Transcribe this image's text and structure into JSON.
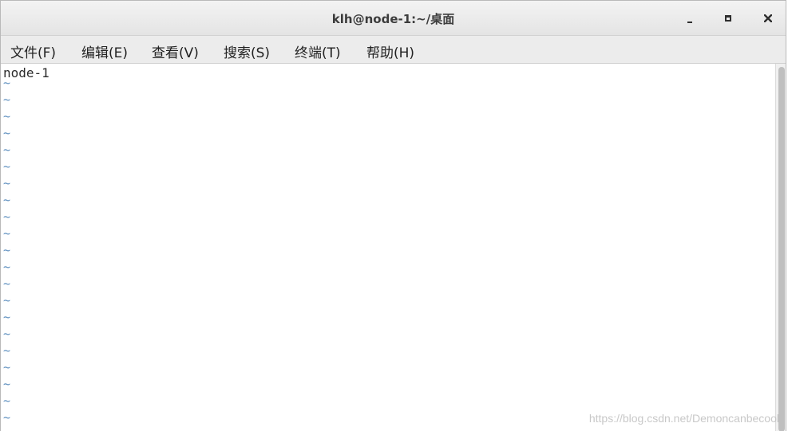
{
  "window": {
    "title": "klh@node-1:~/桌面"
  },
  "menubar": {
    "items": [
      {
        "label": "文件(F)"
      },
      {
        "label": "编辑(E)"
      },
      {
        "label": "查看(V)"
      },
      {
        "label": "搜索(S)"
      },
      {
        "label": "终端(T)"
      },
      {
        "label": "帮助(H)"
      }
    ]
  },
  "terminal": {
    "first_line": "node-1",
    "tilde": "~",
    "tilde_color": "#5d8fbf"
  },
  "watermark": "https://blog.csdn.net/Demoncanbecool"
}
